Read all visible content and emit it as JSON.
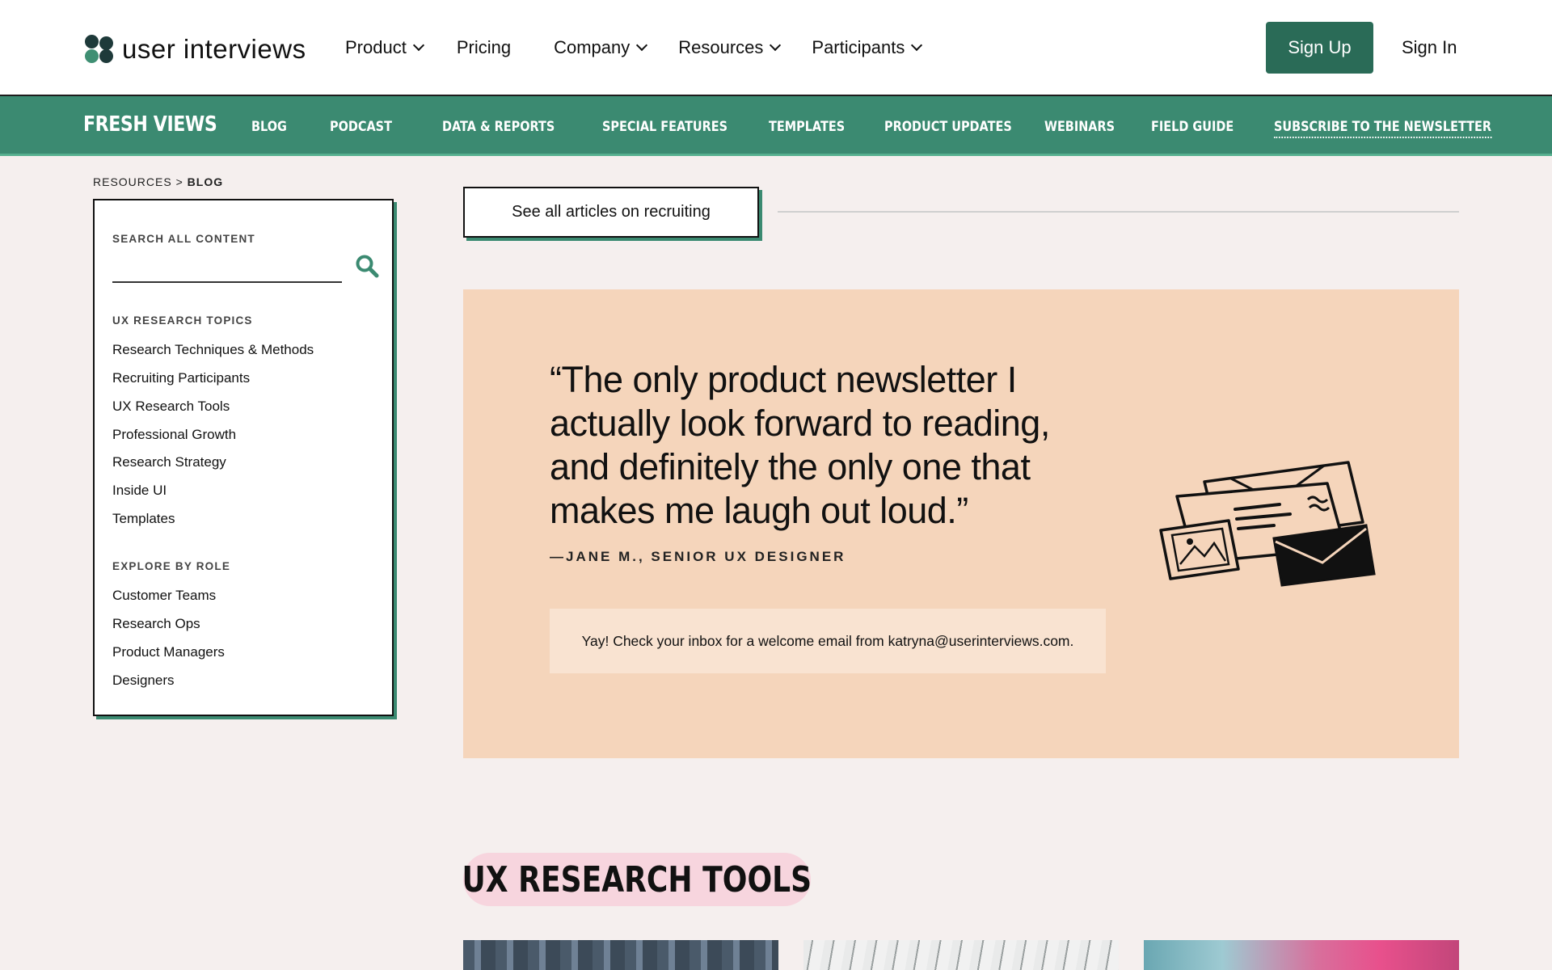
{
  "header": {
    "logo_text": "user interviews",
    "nav": [
      {
        "label": "Product",
        "dropdown": true
      },
      {
        "label": "Pricing",
        "dropdown": false
      },
      {
        "label": "Company",
        "dropdown": true
      },
      {
        "label": "Resources",
        "dropdown": true
      },
      {
        "label": "Participants",
        "dropdown": true
      }
    ],
    "signup_label": "Sign Up",
    "signin_label": "Sign In"
  },
  "subnav": {
    "brand": "FRESH VIEWS",
    "items": [
      "BLOG",
      "PODCAST",
      "DATA & REPORTS",
      "SPECIAL FEATURES",
      "TEMPLATES",
      "PRODUCT UPDATES",
      "WEBINARS",
      "FIELD GUIDE",
      "SUBSCRIBE TO THE NEWSLETTER"
    ]
  },
  "breadcrumb": {
    "parent": "RESOURCES",
    "separator": ">",
    "current": "BLOG"
  },
  "sidebar": {
    "search_label": "SEARCH ALL CONTENT",
    "search_value": "",
    "topics_label": "UX RESEARCH TOPICS",
    "topics": [
      "Research Techniques & Methods",
      "Recruiting Participants",
      "UX Research Tools",
      "Professional Growth",
      "Research Strategy",
      "Inside UI",
      "Templates"
    ],
    "roles_label": "EXPLORE BY ROLE",
    "roles": [
      "Customer Teams",
      "Research Ops",
      "Product Managers",
      "Designers"
    ]
  },
  "main": {
    "see_all_label": "See all articles on recruiting",
    "promo": {
      "quote": "“The only product newsletter I actually look forward to reading, and definitely the only one that makes me laugh out loud.”",
      "author": "—JANE M., SENIOR UX DESIGNER",
      "confirmation": "Yay! Check your inbox for a welcome email from katryna@userinterviews.com."
    },
    "section_heading": "UX RESEARCH TOOLS"
  },
  "colors": {
    "brand_green": "#2a6b57",
    "subnav_green": "#3b8a71",
    "promo_bg": "#f5d5bb",
    "page_bg": "#f5efee",
    "pill_bg": "#f7d5de"
  },
  "icons": [
    "chevron-down-icon",
    "search-icon",
    "envelope-illustration"
  ]
}
